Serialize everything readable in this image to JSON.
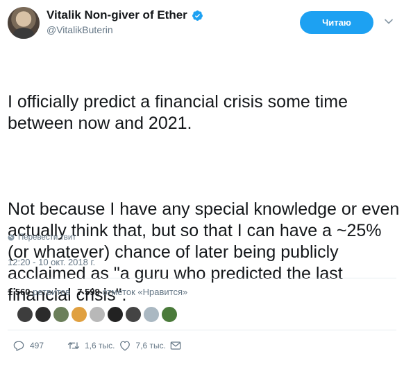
{
  "author": {
    "display_name": "Vitalik Non-giver of Ether",
    "handle": "@VitalikButerin"
  },
  "follow_button": {
    "label": "Читаю"
  },
  "tweet": {
    "paragraphs": [
      "I officially predict a financial crisis some time between now and 2021.",
      "Not because I have any special knowledge or even actually think that, but so that I can have a ~25% (or whatever) chance of later being publicly acclaimed as \"a guru who predicted the last financial crisis\"."
    ]
  },
  "translate": {
    "label": "Перевести твит",
    "icon": "globe-icon"
  },
  "timestamp": "12:20 - 10 окт. 2018 г.",
  "stats": {
    "retweets_count": "1 560",
    "retweets_label": "ретвитов",
    "likes_count": "7 599",
    "likes_label": "отметок «Нравится»"
  },
  "likers": [
    {
      "color": "#3d3d3d"
    },
    {
      "color": "#2b2b2b"
    },
    {
      "color": "#6b7f5a"
    },
    {
      "color": "#e0a040"
    },
    {
      "color": "#b8b8b8"
    },
    {
      "color": "#222222"
    },
    {
      "color": "#444444"
    },
    {
      "color": "#aab8c2"
    },
    {
      "color": "#4a7a3a"
    }
  ],
  "actions": {
    "reply_count": "497",
    "retweet_count": "1,6 тыс.",
    "like_count": "7,6 тыс."
  },
  "colors": {
    "accent": "#1da1f2",
    "secondary_text": "#657786",
    "divider": "#e6ecf0"
  }
}
